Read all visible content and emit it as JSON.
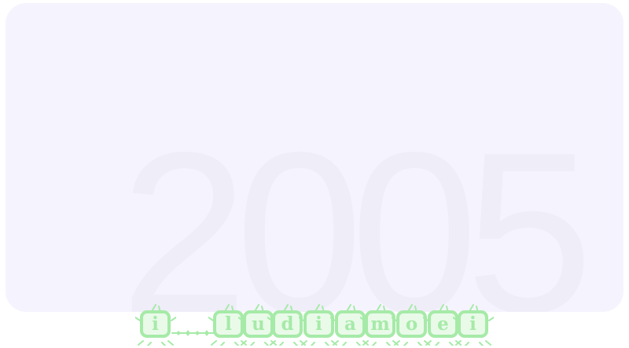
{
  "panel": {
    "year": "2005",
    "background_color": "#f5f4fe",
    "year_color": "#efedf8"
  },
  "word_tiles": {
    "accent_color": "#a6eaa8",
    "letters": [
      "i",
      "l",
      "u",
      "d",
      "i",
      "a",
      "m",
      "o",
      "e",
      "i"
    ],
    "separator_icon": "dotted-spark-dashes"
  }
}
